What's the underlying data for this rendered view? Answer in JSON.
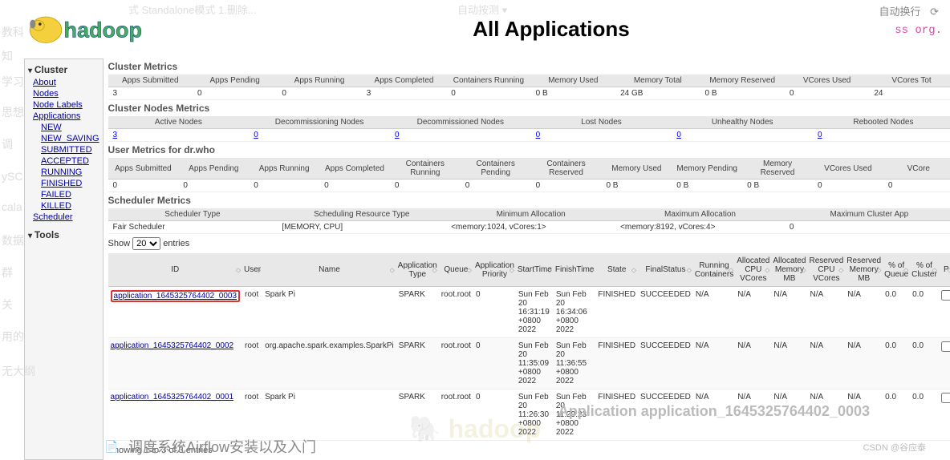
{
  "title": "All Applications",
  "top_right": {
    "label": "自动换行",
    "code_hint": "ss org."
  },
  "sidebar": {
    "cluster": "Cluster",
    "links": [
      "About",
      "Nodes",
      "Node Labels",
      "Applications"
    ],
    "statuses": [
      "NEW",
      "NEW_SAVING",
      "SUBMITTED",
      "ACCEPTED",
      "RUNNING",
      "FINISHED",
      "FAILED",
      "KILLED"
    ],
    "scheduler": "Scheduler",
    "tools": "Tools"
  },
  "sections": {
    "cluster_metrics": "Cluster Metrics",
    "cluster_nodes": "Cluster Nodes Metrics",
    "user_metrics": "User Metrics for dr.who",
    "scheduler_metrics": "Scheduler Metrics"
  },
  "cluster_metrics": {
    "headers": [
      "Apps Submitted",
      "Apps Pending",
      "Apps Running",
      "Apps Completed",
      "Containers Running",
      "Memory Used",
      "Memory Total",
      "Memory Reserved",
      "VCores Used",
      "VCores Tot"
    ],
    "values": [
      "3",
      "0",
      "0",
      "3",
      "0",
      "0 B",
      "24 GB",
      "0 B",
      "0",
      "24"
    ]
  },
  "nodes_metrics": {
    "headers": [
      "Active Nodes",
      "Decommissioning Nodes",
      "Decommissioned Nodes",
      "Lost Nodes",
      "Unhealthy Nodes",
      "Rebooted Nodes"
    ],
    "values": [
      "3",
      "0",
      "0",
      "0",
      "0",
      "0"
    ]
  },
  "user_metrics": {
    "headers": [
      "Apps Submitted",
      "Apps Pending",
      "Apps Running",
      "Apps Completed",
      "Containers Running",
      "Containers Pending",
      "Containers Reserved",
      "Memory Used",
      "Memory Pending",
      "Memory Reserved",
      "VCores Used",
      "VCore"
    ],
    "values": [
      "0",
      "0",
      "0",
      "0",
      "0",
      "0",
      "0",
      "0 B",
      "0 B",
      "0 B",
      "0",
      "0"
    ]
  },
  "scheduler_metrics": {
    "headers": [
      "Scheduler Type",
      "Scheduling Resource Type",
      "Minimum Allocation",
      "Maximum Allocation",
      "Maximum Cluster App"
    ],
    "values": [
      "Fair Scheduler",
      "[MEMORY, CPU]",
      "<memory:1024, vCores:1>",
      "<memory:8192, vCores:4>",
      "0"
    ]
  },
  "show": {
    "label_pre": "Show",
    "value": "20",
    "label_post": "entries"
  },
  "app_headers": [
    "ID",
    "User",
    "Name",
    "Application Type",
    "Queue",
    "Application Priority",
    "StartTime",
    "FinishTime",
    "State",
    "FinalStatus",
    "Running Containers",
    "Allocated CPU VCores",
    "Allocated Memory MB",
    "Reserved CPU VCores",
    "Reserved Memory MB",
    "% of Queue",
    "% of Cluster",
    "P"
  ],
  "apps": [
    {
      "id": "application_1645325764402_0003",
      "user": "root",
      "name": "Spark Pi",
      "type": "SPARK",
      "queue": "root.root",
      "priority": "0",
      "start": "Sun Feb 20 16:31:19 +0800 2022",
      "finish": "Sun Feb 20 16:34:06 +0800 2022",
      "state": "FINISHED",
      "final": "SUCCEEDED",
      "rc": "N/A",
      "acv": "N/A",
      "amm": "N/A",
      "rcv": "N/A",
      "rmm": "N/A",
      "pq": "0.0",
      "pc": "0.0",
      "highlight": true
    },
    {
      "id": "application_1645325764402_0002",
      "user": "root",
      "name": "org.apache.spark.examples.SparkPi",
      "type": "SPARK",
      "queue": "root.root",
      "priority": "0",
      "start": "Sun Feb 20 11:35:09 +0800 2022",
      "finish": "Sun Feb 20 11:36:55 +0800 2022",
      "state": "FINISHED",
      "final": "SUCCEEDED",
      "rc": "N/A",
      "acv": "N/A",
      "amm": "N/A",
      "rcv": "N/A",
      "rmm": "N/A",
      "pq": "0.0",
      "pc": "0.0",
      "highlight": false
    },
    {
      "id": "application_1645325764402_0001",
      "user": "root",
      "name": "Spark Pi",
      "type": "SPARK",
      "queue": "root.root",
      "priority": "0",
      "start": "Sun Feb 20 11:26:30 +0800 2022",
      "finish": "Sun Feb 20 11:29:23 +0800 2022",
      "state": "FINISHED",
      "final": "SUCCEEDED",
      "rc": "N/A",
      "acv": "N/A",
      "amm": "N/A",
      "rcv": "N/A",
      "rmm": "N/A",
      "pq": "0.0",
      "pc": "0.0",
      "highlight": false
    }
  ],
  "footer": "Showing 1 to 3 of 3 entries",
  "detail_title": "Application application_1645325764402_0003",
  "csdn": "CSDN @谷应泰",
  "bottom_tab": "调度系统Airflow安装以及入门",
  "bg_words": [
    "教科",
    "知",
    "学习",
    "思想",
    "调",
    "ySC",
    "cala",
    "数据",
    "群",
    "关",
    "用的",
    "无大纲"
  ],
  "top_bar_hint": "式 Standalone模式 1.删除...",
  "top_bar_hint2": "自动按测 ▾"
}
